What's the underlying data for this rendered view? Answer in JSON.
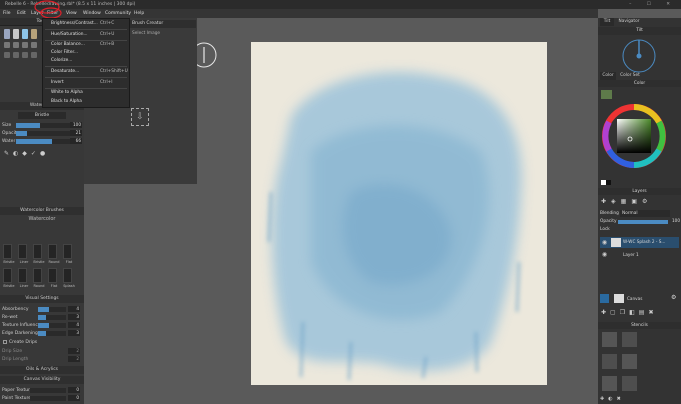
{
  "window": {
    "title": "Rebelle 6 - Rebelledrawing.rbl* (8.5 x 11 inches | 300 dpi)",
    "controls": "–  ☐  ✕"
  },
  "menubar": {
    "items": [
      "File",
      "Edit",
      "Layer",
      "Filter",
      "View",
      "Window",
      "Community",
      "Help"
    ]
  },
  "filter_menu": {
    "items": [
      {
        "label": "Brightness/Contrast...",
        "shortcut": "Ctrl+C"
      },
      {
        "label": "Hue/Saturation...",
        "shortcut": "Ctrl+U"
      },
      {
        "label": "Color Balance...",
        "shortcut": "Ctrl+B"
      },
      {
        "label": "Color Filter...",
        "shortcut": ""
      },
      {
        "label": "Colorize...",
        "shortcut": ""
      },
      {
        "label": "Desaturate...",
        "shortcut": "Ctrl+Shift+U"
      },
      {
        "label": "Invert",
        "shortcut": "Ctrl+I"
      },
      {
        "label": "White to Alpha",
        "shortcut": ""
      },
      {
        "label": "Black to Alpha",
        "shortcut": ""
      }
    ]
  },
  "brush_creator": {
    "title": "Brush Creator",
    "subtitle": "Select Image"
  },
  "left_panel": {
    "tools_title": "Tools",
    "properties_title": "Watercolor",
    "brush_name": "Bristle",
    "sliders": [
      {
        "label": "Size",
        "value": "100",
        "fill": 0.45
      },
      {
        "label": "Opacity",
        "value": "21",
        "fill": 0.21
      },
      {
        "label": "Water",
        "value": "66",
        "fill": 0.66
      }
    ],
    "brushes_title": "Watercolor Brushes",
    "brush_category": "Watercolor",
    "brushes": [
      "Bristle",
      "Liner",
      "Bristle",
      "Round",
      "Flat",
      "Bristle",
      "Liner",
      "Round",
      "Flat",
      "Splash"
    ],
    "visual_title": "Visual Settings",
    "visual": [
      {
        "label": "Absorbency",
        "value": "4",
        "fill": 0.4
      },
      {
        "label": "Re-wet",
        "value": "3",
        "fill": 0.3
      },
      {
        "label": "Texture Influence",
        "value": "4",
        "fill": 0.4
      },
      {
        "label": "Edge Darkening",
        "value": "3",
        "fill": 0.3
      }
    ],
    "create_drips": "Create Drips",
    "drip_rows": [
      {
        "label": "Drip Size",
        "value": "2"
      },
      {
        "label": "Drip Length",
        "value": "2"
      }
    ],
    "oils_acrylics": "Oils & Acrylics",
    "canvas_visibility": "Canvas Visibility",
    "paper_texture": {
      "label": "Paper Texture",
      "value": "0"
    },
    "paint_texture": {
      "label": "Paint Texture",
      "value": "0"
    }
  },
  "right_panel": {
    "tabs": [
      "Tilt",
      "Navigator"
    ],
    "tilt_label": "Tilt",
    "color_tabs": [
      "Color",
      "Color Set"
    ],
    "color_title": "Color",
    "current_color": "#5e7a4a",
    "layers_title": "Layers",
    "blending_label": "Blending",
    "blending_value": "Normal",
    "opacity_label": "Opacity",
    "opacity_value": "100",
    "lock_label": "Lock",
    "layers": [
      {
        "name": "W-WC Splash 2 - S...",
        "selected": true
      },
      {
        "name": "Layer 1",
        "selected": false
      }
    ],
    "canvas_label": "Canvas",
    "stencils_title": "Stencils"
  },
  "annotation_color": "#e0202a",
  "accent_color": "#4b8bc2"
}
